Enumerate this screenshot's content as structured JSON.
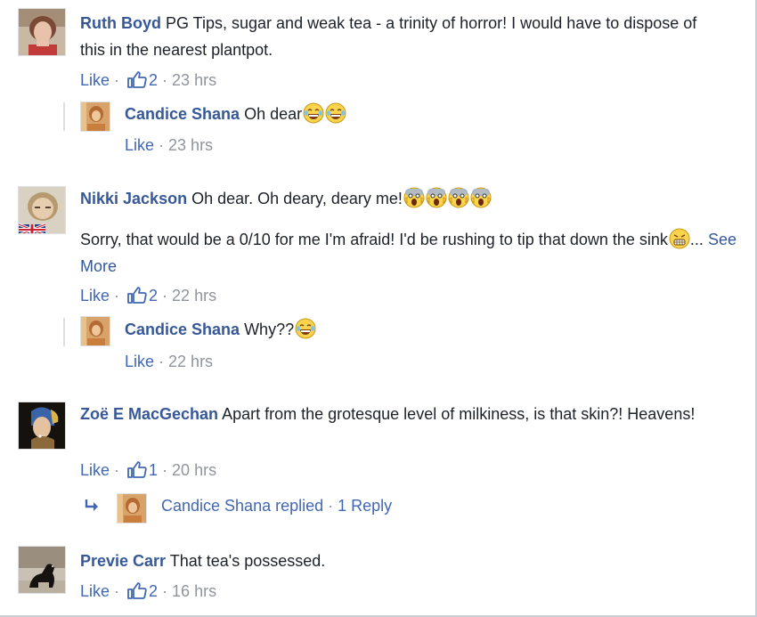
{
  "comments": [
    {
      "author": "Ruth Boyd",
      "text": "PG Tips, sugar and weak tea - a trinity of horror! I would have to dispose of this in the nearest plantpot.",
      "like_label": "Like",
      "likes": "2",
      "time": "23 hrs",
      "replies": [
        {
          "author": "Candice Shana",
          "text": "Oh dear",
          "emojis": [
            "laughing-crying-emoji",
            "laughing-crying-emoji"
          ],
          "like_label": "Like",
          "time": "23 hrs"
        }
      ]
    },
    {
      "author": "Nikki Jackson",
      "text": "Oh dear. Oh deary, deary me!",
      "emojis": [
        "screaming-emoji",
        "screaming-emoji",
        "screaming-emoji",
        "screaming-emoji"
      ],
      "text2": "Sorry, that would be a 0/10 for me I'm afraid! I'd be rushing to tip that down the sink",
      "text2_emoji": "grimacing-emoji",
      "ellipsis": "...",
      "see_more": "See More",
      "like_label": "Like",
      "likes": "2",
      "time": "22 hrs",
      "replies": [
        {
          "author": "Candice Shana",
          "text": "Why??",
          "emojis": [
            "laughing-crying-emoji"
          ],
          "like_label": "Like",
          "time": "22 hrs"
        }
      ]
    },
    {
      "author": "Zoë E MacGechan",
      "text": "Apart from the grotesque level of milkiness, is that skin?! Heavens!",
      "like_label": "Like",
      "likes": "1",
      "time": "20 hrs",
      "replied": {
        "who": "Candice Shana replied",
        "separator": " · ",
        "count": "1 Reply"
      }
    },
    {
      "author": "Previe Carr",
      "text": "That tea's possessed.",
      "like_label": "Like",
      "likes": "2",
      "time": "16 hrs"
    }
  ],
  "ui": {
    "dot": " · ",
    "accent": "#365899",
    "link": "#4267b2",
    "meta_gray": "#90949c"
  }
}
